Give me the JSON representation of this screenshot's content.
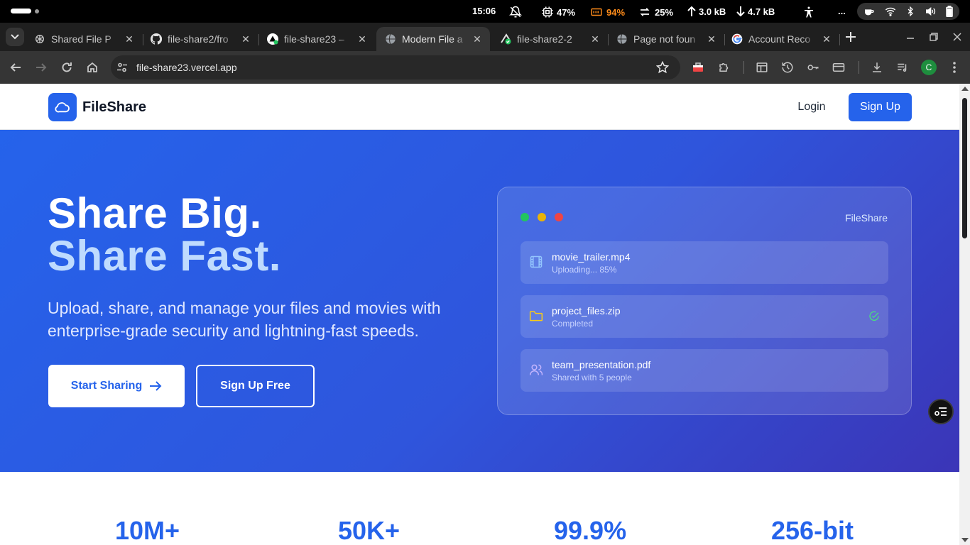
{
  "statusbar": {
    "time": "15:06",
    "cpu": "47%",
    "battery": "94%",
    "sync": "25%",
    "upload": "3.0 kB",
    "download": "4.7 kB",
    "more": "..."
  },
  "tabs": [
    {
      "title": "Shared File P",
      "icon": "openai-icon",
      "active": false
    },
    {
      "title": "file-share2/fro",
      "icon": "github-icon",
      "active": false
    },
    {
      "title": "file-share23 –",
      "icon": "vercel-icon",
      "active": false
    },
    {
      "title": "Modern File a",
      "icon": "globe-icon",
      "active": true
    },
    {
      "title": "file-share2-2",
      "icon": "deploy-check-icon",
      "active": false
    },
    {
      "title": "Page not foun",
      "icon": "globe-icon",
      "active": false
    },
    {
      "title": "Account Reco",
      "icon": "google-icon",
      "active": false
    }
  ],
  "address_bar": {
    "url": "file-share23.vercel.app"
  },
  "profile": {
    "initial": "C"
  },
  "site": {
    "brand": "FileShare",
    "nav": {
      "login": "Login",
      "signup": "Sign Up"
    },
    "hero": {
      "title_line1": "Share Big.",
      "title_line2": "Share Fast.",
      "subtitle": "Upload, share, and manage your files and movies with enterprise-grade security and lightning-fast speeds.",
      "primary_cta": "Start Sharing",
      "secondary_cta": "Sign Up Free"
    },
    "preview_card": {
      "title": "FileShare",
      "files": [
        {
          "name": "movie_trailer.mp4",
          "status": "Uploading... 85%",
          "icon": "film-icon",
          "icon_color": "#93c5fd"
        },
        {
          "name": "project_files.zip",
          "status": "Completed",
          "icon": "folder-icon",
          "icon_color": "#facc15",
          "check": true
        },
        {
          "name": "team_presentation.pdf",
          "status": "Shared with 5 people",
          "icon": "users-icon",
          "icon_color": "#c4b5fd"
        }
      ]
    },
    "stats": [
      "10M+",
      "50K+",
      "99.9%",
      "256-bit"
    ]
  },
  "colors": {
    "primary": "#2563eb",
    "hero_light_text": "#bfdbfe",
    "traffic_green": "#22c55e",
    "traffic_yellow": "#eab308",
    "traffic_red": "#ef4444",
    "battery_orange": "#ff8c1a"
  }
}
